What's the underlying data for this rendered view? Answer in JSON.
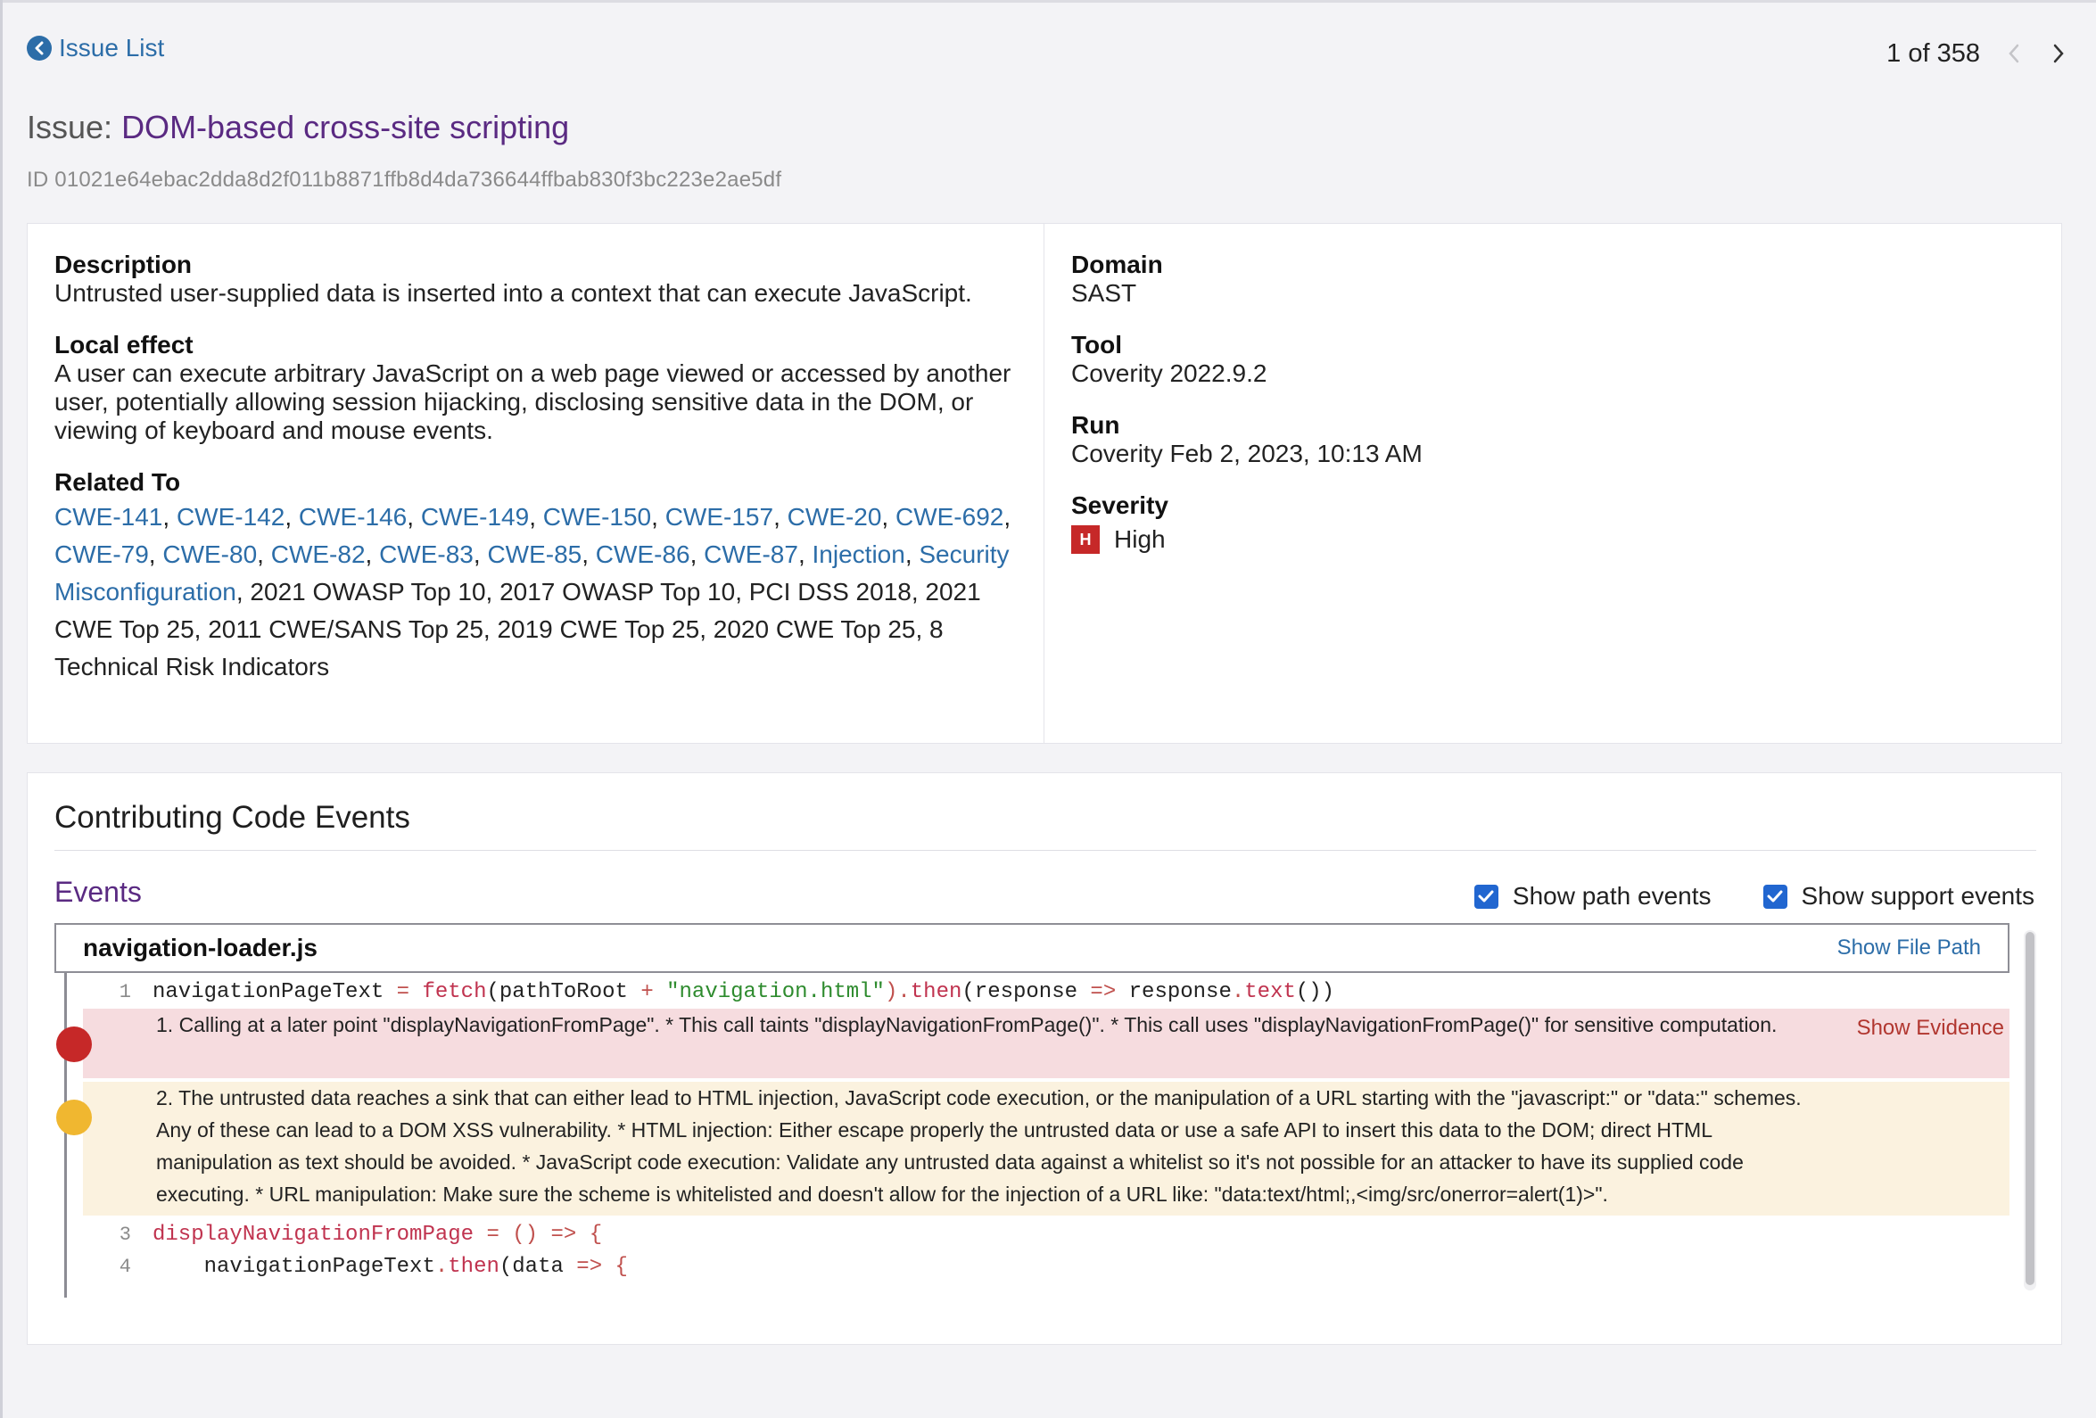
{
  "header": {
    "back_label": "Issue List",
    "pager_text": "1 of 358",
    "issue_prefix": "Issue: ",
    "issue_name": "DOM-based cross-site scripting",
    "issue_id": "ID 01021e64ebac2dda8d2f011b8871ffb8d4da736644ffbab830f3bc223e2ae5df"
  },
  "details": {
    "description_label": "Description",
    "description_value": "Untrusted user-supplied data is inserted into a context that can execute JavaScript.",
    "local_effect_label": "Local effect",
    "local_effect_value": "A user can execute arbitrary JavaScript on a web page viewed or accessed by another user, potentially allowing session hijacking, disclosing sensitive data in the DOM, or viewing of keyboard and mouse events.",
    "related_label": "Related To",
    "related_links": [
      "CWE-141",
      "CWE-142",
      "CWE-146",
      "CWE-149",
      "CWE-150",
      "CWE-157",
      "CWE-20",
      "CWE-692",
      "CWE-79",
      "CWE-80",
      "CWE-82",
      "CWE-83",
      "CWE-85",
      "CWE-86",
      "CWE-87",
      "Injection",
      "Security Misconfiguration"
    ],
    "related_text": ", 2021 OWASP Top 10, 2017 OWASP Top 10, PCI DSS 2018, 2021 CWE Top 25, 2011 CWE/SANS Top 25, 2019 CWE Top 25, 2020 CWE Top 25, 8 Technical Risk Indicators",
    "domain_label": "Domain",
    "domain_value": "SAST",
    "tool_label": "Tool",
    "tool_value": "Coverity 2022.9.2",
    "run_label": "Run",
    "run_value": "Coverity Feb 2, 2023, 10:13 AM",
    "severity_label": "Severity",
    "severity_badge": "H",
    "severity_value": "High",
    "severity_color": "#c62828"
  },
  "events": {
    "heading": "Contributing Code Events",
    "subheading": "Events",
    "show_path_label": "Show path events",
    "show_path_checked": true,
    "show_support_label": "Show support events",
    "show_support_checked": true,
    "file_name": "navigation-loader.js",
    "show_file_path": "Show File Path",
    "show_evidence": "Show Evidence",
    "line1_no": "1",
    "event1_text": "1. Calling at a later point \"displayNavigationFromPage\". * This call taints \"displayNavigationFromPage()\". * This call uses \"displayNavigationFromPage()\" for sensitive computation.",
    "event2_text": "2. The untrusted data reaches a sink that can either lead to HTML injection, JavaScript code execution, or the manipulation of a URL starting with the \"javascript:\" or \"data:\" schemes. Any of these can lead to a DOM XSS vulnerability. * HTML injection: Either escape properly the untrusted data or use a safe API to insert this data to the DOM; direct HTML manipulation as text should be avoided. * JavaScript code execution: Validate any untrusted data against a whitelist so it's not possible for an attacker to have its supplied code executing. * URL manipulation: Make sure the scheme is whitelisted and doesn't allow for the injection of a URL like: \"data:text/html;,<img/src/onerror=alert(1)>\".",
    "line3_no": "3",
    "line4_no": "4",
    "code": {
      "l1_a": "navigationPageText",
      "l1_b": " = ",
      "l1_c": "fetch",
      "l1_d": "(pathToRoot ",
      "l1_e": "+",
      "l1_f": " \"navigation.html\"",
      "l1_g": ").",
      "l1_h": "then",
      "l1_i": "(response ",
      "l1_j": "=>",
      "l1_k": " response",
      "l1_l": ".",
      "l1_m": "text",
      "l1_n": "())",
      "l3_a": "displayNavigationFromPage",
      "l3_b": " = () ",
      "l3_c": "=>",
      "l3_d": " {",
      "l4_a": "    navigationPageText",
      "l4_b": ".",
      "l4_c": "then",
      "l4_d": "(data ",
      "l4_e": "=>",
      "l4_f": " {"
    }
  },
  "colors": {
    "link": "#2c6da8",
    "title_accent": "#5a2a82",
    "event_red_bg": "#f6dcdf",
    "event_yellow_bg": "#fbf2df",
    "marker_red": "#c62828",
    "marker_yellow": "#f0b730",
    "checkbox": "#2166d0"
  }
}
